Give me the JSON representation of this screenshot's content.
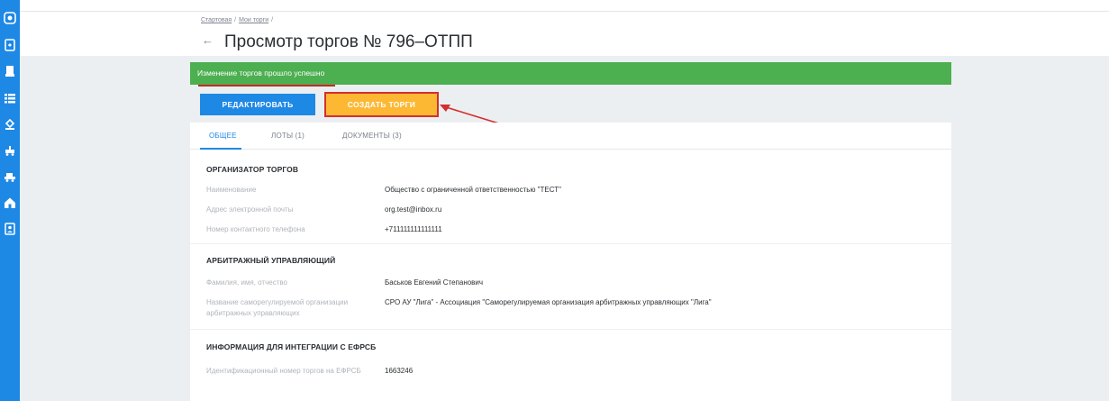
{
  "sidebar": {
    "icons": [
      "logo-icon",
      "document-icon",
      "certificate-icon",
      "list-icon",
      "gavel-icon",
      "transport-icon",
      "vehicle-icon",
      "home-icon",
      "contacts-icon"
    ],
    "color": "#1e88e5"
  },
  "breadcrumb": {
    "home": "Стартовая",
    "current": "Мои торги",
    "separator": "/"
  },
  "header": {
    "back_icon": "arrow-left-icon",
    "title": "Просмотр торгов № 796–ОТПП"
  },
  "banner": {
    "text": "Изменение торгов прошло успешно",
    "color": "#4caf50"
  },
  "actions": {
    "edit_label": "РЕДАКТИРОВАТЬ",
    "create_label": "СОЗДАТЬ ТОРГИ"
  },
  "tabs": [
    {
      "label": "ОБЩЕЕ",
      "active": true
    },
    {
      "label": "ЛОТЫ (1)",
      "active": false
    },
    {
      "label": "ДОКУМЕНТЫ (3)",
      "active": false
    }
  ],
  "organizer": {
    "title": "ОРГАНИЗАТОР ТОРГОВ",
    "fields": [
      {
        "label": "Наименование",
        "value": "Общество с ограниченной ответственностью \"ТЕСТ\""
      },
      {
        "label": "Адрес электронной почты",
        "value": "org.test@inbox.ru"
      },
      {
        "label": "Номер контактного телефона",
        "value": "+711111111111111"
      }
    ]
  },
  "manager": {
    "title": "АРБИТРАЖНЫЙ УПРАВЛЯЮЩИЙ",
    "fields": [
      {
        "label": "Фамилия, имя, отчество",
        "value": "Баськов Евгений Степанович"
      },
      {
        "label": "Название саморегулируемой организации арбитражных управляющих",
        "value": "СРО АУ \"Лига\" - Ассоциация \"Саморегулируемая организация арбитражных управляющих \"Лига\""
      }
    ]
  },
  "efrsb": {
    "title": "ИНФОРМАЦИЯ ДЛЯ ИНТЕГРАЦИИ С ЕФРСБ",
    "fields": [
      {
        "label": "Идентификационный номер торгов на ЕФРСБ",
        "value": "1663246"
      }
    ]
  }
}
